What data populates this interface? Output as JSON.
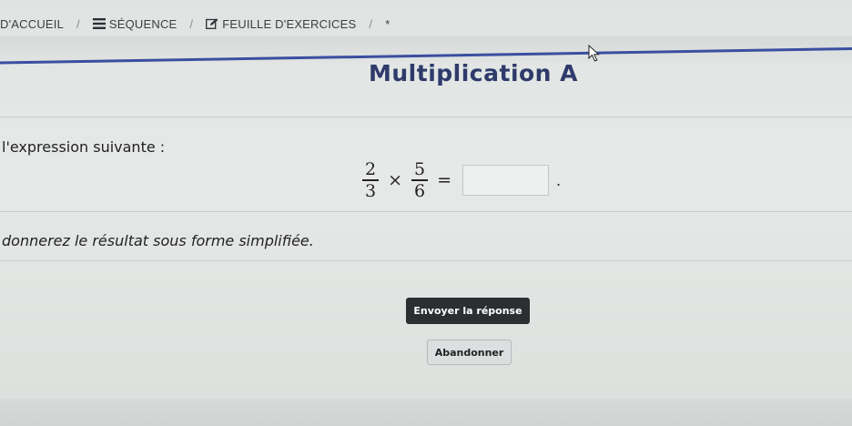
{
  "breadcrumb": {
    "home_label": "D'ACCUEIL",
    "sequence_label": "SÉQUENCE",
    "worksheet_label": "FEUILLE D'EXERCICES",
    "current_label": "*",
    "separator": "/"
  },
  "exercise": {
    "title": "Multiplication A",
    "instruction": "l'expression suivante :",
    "fraction1": {
      "numerator": "2",
      "denominator": "3"
    },
    "operator": "×",
    "fraction2": {
      "numerator": "5",
      "denominator": "6"
    },
    "equals": "=",
    "answer_value": "",
    "trailing_period": ".",
    "note": "donnerez le résultat sous forme simplifiée."
  },
  "actions": {
    "submit_label": "Envoyer la réponse",
    "cancel_label": "Abandonner"
  },
  "colors": {
    "accent_line": "#3a4fa0",
    "title": "#2f3a6b",
    "submit_bg": "#2c2f31"
  }
}
